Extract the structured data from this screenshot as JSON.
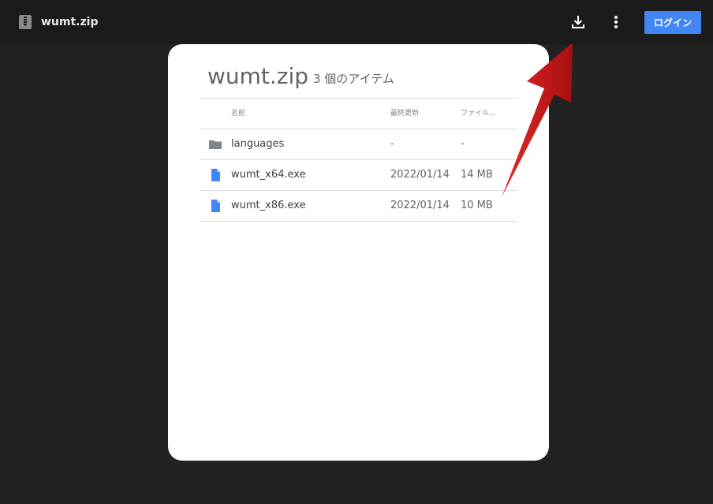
{
  "header": {
    "app_icon": "zip-archive-icon",
    "title": "wumt.zip",
    "download_icon": "download-icon",
    "more_icon": "more-vert-icon",
    "login_label": "ログイン",
    "accent_color": "#4285f4"
  },
  "card": {
    "title": "wumt.zip",
    "item_count": "3 個のアイテム",
    "columns": {
      "name": "名前",
      "modified": "最終更新",
      "size": "ファイル..."
    },
    "rows": [
      {
        "icon": "folder-icon",
        "name": "languages",
        "modified": "-",
        "size": "-"
      },
      {
        "icon": "file-icon",
        "name": "wumt_x64.exe",
        "modified": "2022/01/14",
        "size": "14 MB"
      },
      {
        "icon": "file-icon",
        "name": "wumt_x86.exe",
        "modified": "2022/01/14",
        "size": "10 MB"
      }
    ]
  },
  "annotation": {
    "icon": "red-arrow-pointer",
    "color": "#d21f1f"
  }
}
